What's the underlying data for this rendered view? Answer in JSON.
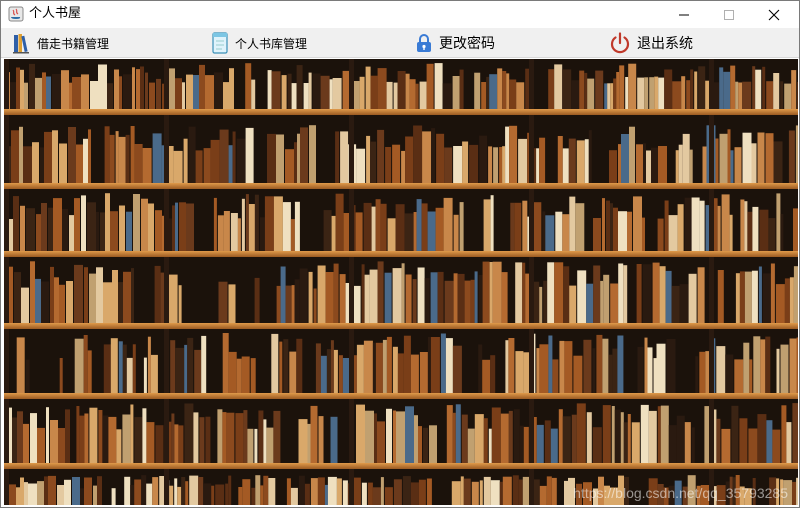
{
  "window": {
    "title": "个人书屋",
    "controls": {
      "minimize": "─",
      "maximize": "☐",
      "close": "✕"
    }
  },
  "menu": {
    "items": [
      {
        "label": "借走书籍管理",
        "icon": "books-icon"
      },
      {
        "label": "个人书库管理",
        "icon": "document-icon"
      },
      {
        "label": "更改密码",
        "icon": "lock-icon"
      },
      {
        "label": "退出系统",
        "icon": "power-icon"
      }
    ]
  },
  "content": {
    "image": "bookshelf-background",
    "watermark": "https://blog.csdn.net/qq_35793285"
  },
  "colors": {
    "menubar_bg": "#f0f0f0",
    "shelf_wood": "#c47a32",
    "power_icon": "#c0392b",
    "lock_icon": "#3a7bd5"
  }
}
